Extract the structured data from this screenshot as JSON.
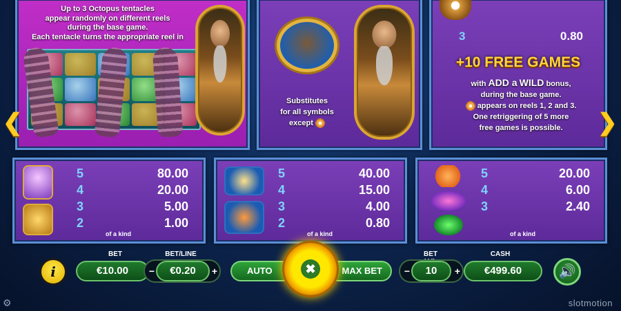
{
  "panel1": {
    "rules_lines": [
      "Up to 3 Octopus tentacles",
      "appear randomly on different reels",
      "during the base game.",
      "Each tentacle turns the appropriate reel in"
    ]
  },
  "panel2": {
    "substitutes_lines": [
      "Substitutes",
      "for all symbols",
      "except"
    ]
  },
  "panel3": {
    "count": "3",
    "value": "0.80",
    "free_games": "+10 FREE GAMES",
    "desc": {
      "with": "with",
      "add_a": "ADD a",
      "wild": "WILD",
      "bonus": "bonus,",
      "line2": "during the base game.",
      "line3": "appears on reels 1, 2 and 3.",
      "line4": "One retriggering of 5 more",
      "line5": "free games is possible."
    }
  },
  "paytables": [
    {
      "rows": [
        {
          "k": "5",
          "v": "80.00"
        },
        {
          "k": "4",
          "v": "20.00"
        },
        {
          "k": "3",
          "v": "5.00"
        },
        {
          "k": "2",
          "v": "1.00"
        }
      ],
      "of_a_kind": "of a kind"
    },
    {
      "rows": [
        {
          "k": "5",
          "v": "40.00"
        },
        {
          "k": "4",
          "v": "15.00"
        },
        {
          "k": "3",
          "v": "4.00"
        },
        {
          "k": "2",
          "v": "0.80"
        }
      ],
      "of_a_kind": "of a kind"
    },
    {
      "rows": [
        {
          "k": "5",
          "v": "20.00"
        },
        {
          "k": "4",
          "v": "6.00"
        },
        {
          "k": "3",
          "v": "2.40"
        }
      ],
      "of_a_kind": "of a kind"
    }
  ],
  "controls": {
    "bet_label": "BET",
    "bet_value": "€10.00",
    "betline_label": "BET/LINE",
    "betline_value": "€0.20",
    "minus": "−",
    "plus": "+",
    "auto_label": "AUTO",
    "maxbet_label": "MAX BET",
    "betlvl_label": "BET LVL",
    "betlvl_value": "10",
    "cash_label": "CASH",
    "cash_value": "€499.60",
    "info_glyph": "i",
    "spin_glyph": "✖",
    "sound_glyph": "🔊"
  },
  "arrows": {
    "left": "❮",
    "right": "❯"
  },
  "brand": "slotmotion",
  "settings_glyph": "⚙"
}
